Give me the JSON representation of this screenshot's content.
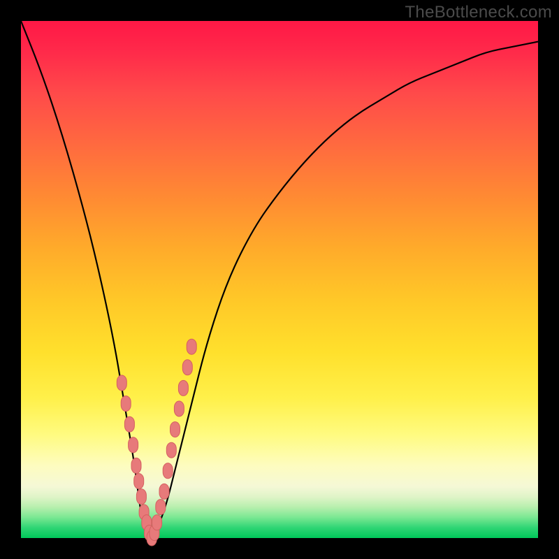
{
  "watermark": "TheBottleneck.com",
  "colors": {
    "frame": "#000000",
    "curve_stroke": "#000000",
    "marker_fill": "#e77a7a",
    "marker_stroke": "#d46060",
    "gradient_top": "#ff1846",
    "gradient_bottom": "#00c85a"
  },
  "chart_data": {
    "type": "line",
    "title": "",
    "xlabel": "",
    "ylabel": "",
    "x_range": [
      0,
      100
    ],
    "y_range": [
      0,
      100
    ],
    "series": [
      {
        "name": "bottleneck-curve",
        "x": [
          0,
          4,
          8,
          12,
          15,
          18,
          20,
          22,
          23,
          24,
          25,
          26,
          28,
          30,
          33,
          36,
          40,
          45,
          50,
          55,
          60,
          65,
          70,
          75,
          80,
          85,
          90,
          95,
          100
        ],
        "values": [
          100,
          90,
          78,
          64,
          52,
          38,
          26,
          14,
          6,
          1,
          0,
          1,
          6,
          14,
          26,
          38,
          50,
          60,
          67,
          73,
          78,
          82,
          85,
          88,
          90,
          92,
          94,
          95,
          96
        ]
      }
    ],
    "markers": {
      "name": "highlight-points",
      "x": [
        19.5,
        20.3,
        21.0,
        21.7,
        22.3,
        22.8,
        23.3,
        23.8,
        24.3,
        24.8,
        25.3,
        25.8,
        26.3,
        27.0,
        27.7,
        28.4,
        29.1,
        29.8,
        30.6,
        31.4,
        32.2,
        33.0
      ],
      "values": [
        30,
        26,
        22,
        18,
        14,
        11,
        8,
        5,
        3,
        1,
        0,
        1,
        3,
        6,
        9,
        13,
        17,
        21,
        25,
        29,
        33,
        37
      ]
    }
  }
}
